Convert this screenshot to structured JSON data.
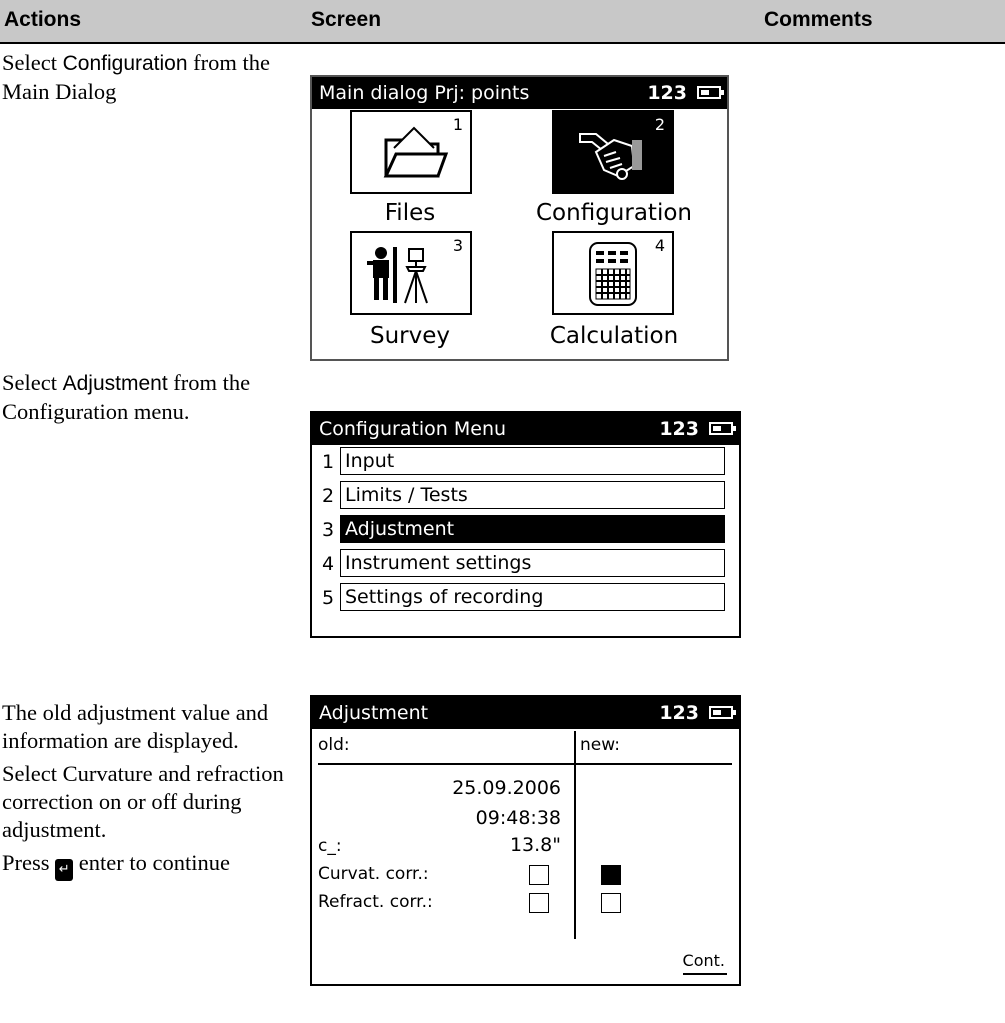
{
  "header": {
    "actions": "Actions",
    "screen": "Screen",
    "comments": "Comments"
  },
  "rows": [
    {
      "action": {
        "pre": "Select ",
        "term": "Configuration",
        "post": " from the Main Dialog"
      }
    },
    {
      "action": {
        "pre": "Select ",
        "term": "Adjustment",
        "post": " from the Configuration menu."
      }
    },
    {
      "action": {
        "p1": "The old adjustment value and information are displayed.",
        "p2": "Select Curvature and refraction correction on or off during adjustment.",
        "p3_pre": "Press ",
        "p3_key": "↵",
        "p3_post": " enter to continue"
      }
    }
  ],
  "main_dialog": {
    "title": "Main dialog  Prj: points",
    "indicator": "123",
    "tiles": [
      {
        "num": "1",
        "label": "Files",
        "icon": "folder-icon",
        "selected": false
      },
      {
        "num": "2",
        "label": "Configuration",
        "icon": "wrench-hand-icon",
        "selected": true
      },
      {
        "num": "3",
        "label": "Survey",
        "icon": "surveyor-icon",
        "selected": false
      },
      {
        "num": "4",
        "label": "Calculation",
        "icon": "calculator-icon",
        "selected": false
      }
    ]
  },
  "config_menu": {
    "title": "Configuration Menu",
    "indicator": "123",
    "items": [
      {
        "num": "1",
        "label": "Input",
        "selected": false
      },
      {
        "num": "2",
        "label": "Limits / Tests",
        "selected": false
      },
      {
        "num": "3",
        "label": "Adjustment",
        "selected": true
      },
      {
        "num": "4",
        "label": "Instrument settings",
        "selected": false
      },
      {
        "num": "5",
        "label": "Settings of recording",
        "selected": false
      }
    ]
  },
  "adjustment": {
    "title": "Adjustment",
    "indicator": "123",
    "old_label": "old:",
    "new_label": "new:",
    "date": "25.09.2006",
    "time": "09:48:38",
    "c_label": "c_:",
    "c_value": "13.8\"",
    "curvat_label": "Curvat. corr.:",
    "refract_label": "Refract. corr.:",
    "curvat_old": false,
    "curvat_new": true,
    "refract_old": false,
    "refract_new": false,
    "softkey": "Cont."
  }
}
